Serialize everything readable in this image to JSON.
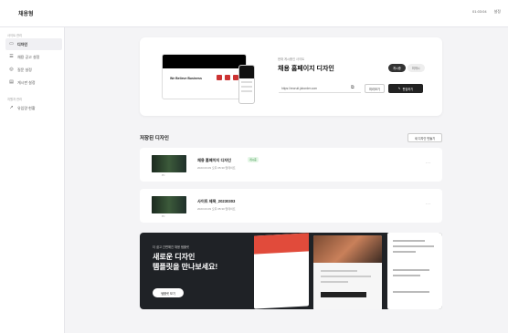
{
  "app": {
    "brand": "채용형",
    "top_right": [
      "01:03:04",
      "설정"
    ]
  },
  "sidebar": {
    "section1": "사이트 관리",
    "items": [
      {
        "label": "디자인",
        "icon": "layout-icon",
        "active": true
      },
      {
        "label": "채용 공고 설정",
        "icon": "list-icon",
        "active": false
      },
      {
        "label": "질문 설정",
        "icon": "question-icon",
        "active": false
      },
      {
        "label": "게시판 설정",
        "icon": "board-icon",
        "active": false
      }
    ],
    "section2": "지원자 관리",
    "items2": [
      {
        "label": "유입량 현황",
        "icon": "chart-icon",
        "active": false
      }
    ]
  },
  "hero": {
    "label": "현재 게시중인 사이트",
    "title": "채용 홈페이지 디자인",
    "mock_title": "We Believe Business",
    "toggles": [
      "게시중",
      "미게시"
    ],
    "url": "https://recruit.joborder.com",
    "preview_label": "미리보기",
    "edit_label": "편집하기"
  },
  "saved": {
    "title": "저장된 디자인",
    "new_button": "새 디자인 만들기",
    "rows": [
      {
        "title": "채용 홈페이지 디자인",
        "badge": "게시중",
        "date": "2023.03.09 오후 05:30 업데이트",
        "thumb_label": "PC"
      },
      {
        "title": "사이트 제목_20230303",
        "badge": "",
        "date": "2023.03.09 오후 05:30 업데이트",
        "thumb_label": "PC"
      }
    ]
  },
  "banner": {
    "kicker": "더 쉽고 간편해진 채용 템플릿",
    "title_line1": "새로운 디자인",
    "title_line2": "템플릿을 만나보세요!",
    "button": "템플릿 보기"
  }
}
